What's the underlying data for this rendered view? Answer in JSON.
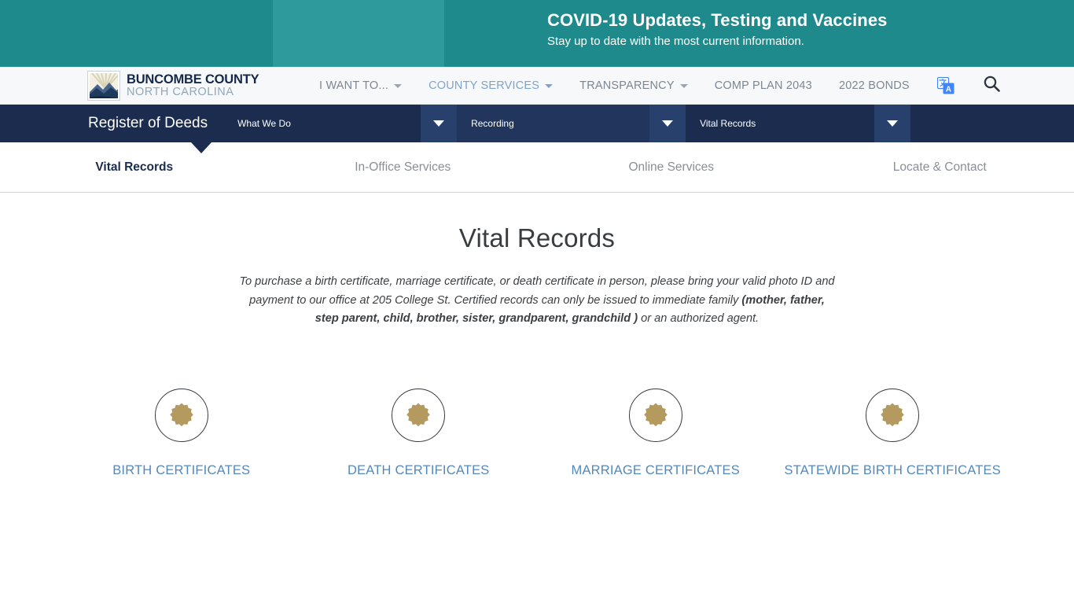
{
  "banner": {
    "title": "COVID-19 Updates, Testing and Vaccines",
    "subtitle": "Stay up to date with the most current information.",
    "bg_color": "#1f8a8c",
    "art_alt": "healthcare-workers-illustration"
  },
  "topnav": {
    "brand_line1": "BUNCOMBE COUNTY",
    "brand_line2": "NORTH CAROLINA",
    "brand_logo": "mountain-sunrise-logo",
    "links": [
      {
        "label": "I WANT TO...",
        "has_caret": true,
        "active": false
      },
      {
        "label": "COUNTY SERVICES",
        "has_caret": true,
        "active": true
      },
      {
        "label": "TRANSPARENCY",
        "has_caret": true,
        "active": false
      },
      {
        "label": "COMP PLAN 2043",
        "has_caret": false,
        "active": false
      },
      {
        "label": "2022 BONDS",
        "has_caret": false,
        "active": false
      }
    ],
    "translate_icon": "translate-icon",
    "search_icon": "search-icon",
    "active_color": "#7fa3ce"
  },
  "breadcrumb": {
    "department": "Register of Deeds",
    "levels": [
      {
        "label": "What We Do"
      },
      {
        "label": "Recording"
      },
      {
        "label": "Vital Records"
      }
    ],
    "bg_color": "#1b2c4f"
  },
  "tabs": [
    {
      "label": "Vital Records",
      "active": true
    },
    {
      "label": "In-Office Services",
      "active": false
    },
    {
      "label": "Online Services",
      "active": false
    },
    {
      "label": "Locate & Contact",
      "active": false
    }
  ],
  "main": {
    "title": "Vital Records",
    "intro_part1": "To purchase a birth certificate, marriage certificate, or death certificate in person, please bring your valid photo ID and payment to our office at 205 College St. Certified records can only be issued to immediate family ",
    "intro_bold": "(mother, father, step parent, child, brother, sister, grandparent, grandchild )",
    "intro_part2": " or an authorized agent.",
    "tiles": [
      {
        "label": "BIRTH CERTIFICATES",
        "icon": "certificate-seal-icon"
      },
      {
        "label": "DEATH CERTIFICATES",
        "icon": "certificate-seal-icon"
      },
      {
        "label": "MARRIAGE CERTIFICATES",
        "icon": "certificate-seal-icon"
      },
      {
        "label": "STATEWIDE BIRTH CERTIFICATES",
        "icon": "certificate-seal-icon"
      }
    ],
    "link_color": "#5289bd",
    "seal_color": "#b49a5e"
  }
}
